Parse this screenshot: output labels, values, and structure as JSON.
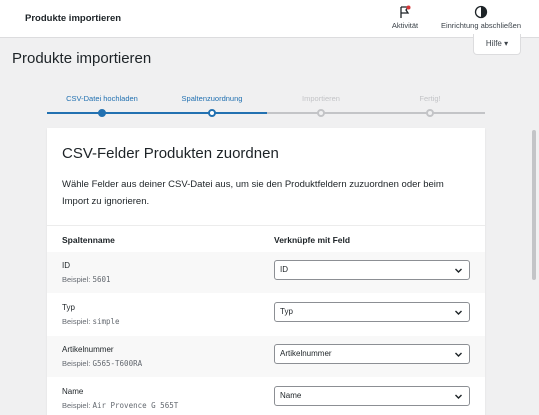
{
  "topbar": {
    "title": "Produkte importieren",
    "activity_label": "Aktivität",
    "finish_setup_label": "Einrichtung abschließen"
  },
  "help": {
    "label": "Hilfe ▾"
  },
  "page": {
    "title": "Produkte importieren"
  },
  "steps": [
    {
      "label": "CSV-Datei hochladen",
      "state": "done"
    },
    {
      "label": "Spaltenzuordnung",
      "state": "current"
    },
    {
      "label": "Importieren",
      "state": "pending"
    },
    {
      "label": "Fertig!",
      "state": "pending"
    }
  ],
  "card": {
    "heading": "CSV-Felder Produkten zuordnen",
    "description": "Wähle Felder aus deiner CSV-Datei aus, um sie den Produktfeldern zuzuordnen oder beim Import zu ignorieren.",
    "col_name_header": "Spaltenname",
    "col_map_header": "Verknüpfe mit Feld",
    "example_prefix": "Beispiel:",
    "rows": [
      {
        "name": "ID",
        "example": "5601",
        "mapped": "ID"
      },
      {
        "name": "Typ",
        "example": "simple",
        "mapped": "Typ"
      },
      {
        "name": "Artikelnummer",
        "example": "G565-T600RA",
        "mapped": "Artikelnummer"
      },
      {
        "name": "Name",
        "example": "Air Provence G 565T",
        "mapped": "Name"
      }
    ]
  },
  "colors": {
    "accent": "#2271b1",
    "inactive": "#c3c4c7",
    "background": "#f0f0f1",
    "activity_icon_red": "#d63638"
  },
  "icons": {
    "activity": "flag-icon",
    "finish_setup": "half-circle-icon",
    "select": "chevron-down-icon"
  }
}
